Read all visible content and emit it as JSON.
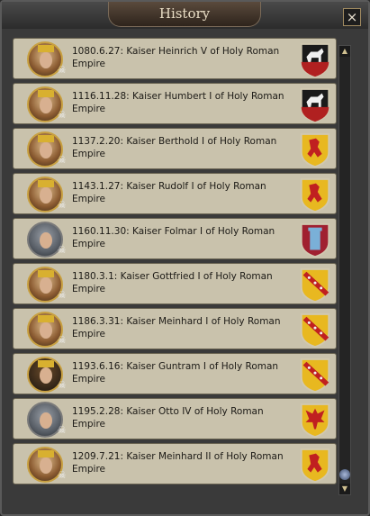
{
  "window": {
    "title": "History"
  },
  "entries": [
    {
      "text": "1080.6.27: Kaiser Heinrich V of Holy Roman Empire",
      "coa": "black-horse",
      "portrait": "gold"
    },
    {
      "text": "1116.11.28: Kaiser Humbert I of Holy Roman Empire",
      "coa": "black-horse",
      "portrait": "gold"
    },
    {
      "text": "1137.2.20: Kaiser Berthold I of Holy Roman Empire",
      "coa": "gold-lion",
      "portrait": "gold"
    },
    {
      "text": "1143.1.27: Kaiser Rudolf I of Holy Roman Empire",
      "coa": "gold-lion",
      "portrait": "gold"
    },
    {
      "text": "1160.11.30: Kaiser Folmar I of Holy Roman Empire",
      "coa": "tower",
      "portrait": "plain"
    },
    {
      "text": "1180.3.1: Kaiser Gottfried I of Holy Roman Empire",
      "coa": "bend-eagles",
      "portrait": "gold"
    },
    {
      "text": "1186.3.31: Kaiser Meinhard I of Holy Roman Empire",
      "coa": "bend-eagles",
      "portrait": "gold"
    },
    {
      "text": "1193.6.16: Kaiser Guntram I of Holy Roman Empire",
      "coa": "bend-eagles",
      "portrait": "dark"
    },
    {
      "text": "1195.2.28: Kaiser Otto IV of Holy Roman Empire",
      "coa": "gold-eagle",
      "portrait": "plain"
    },
    {
      "text": "1209.7.21: Kaiser Meinhard II of Holy Roman Empire",
      "coa": "gold-lion",
      "portrait": "gold"
    }
  ],
  "icons": {
    "close": "×",
    "skull": "☠",
    "scroll_up": "▲",
    "scroll_down": "▼"
  }
}
